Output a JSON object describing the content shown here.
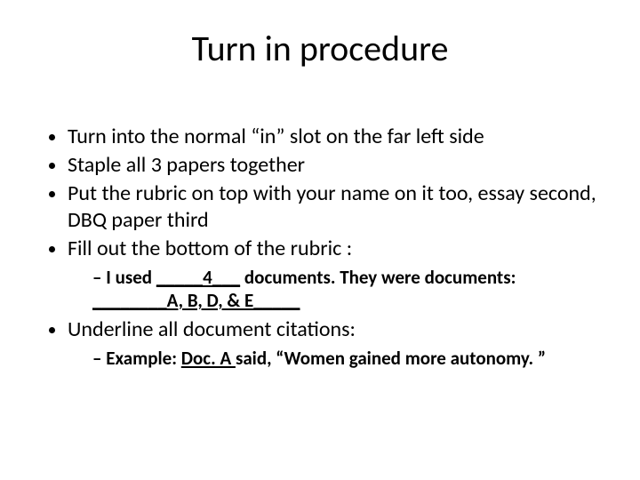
{
  "title": "Turn in procedure",
  "bullets": {
    "b1": "Turn into the normal “in” slot on the far left side",
    "b2": "Staple all 3 papers together",
    "b3": "Put the rubric on top with your name on it too, essay second, DBQ paper third",
    "b4": "Fill out the bottom of the rubric :",
    "b4sub": {
      "prefix": "I used ",
      "blank1": "_____4___",
      "mid": " documents.  They were documents: ",
      "blank2": "________A, B, D, & E_____"
    },
    "b5": "Underline all document citations:",
    "b5sub": {
      "prefix": "Example: ",
      "doc": "Doc. A ",
      "rest": "said, “Women gained more autonomy. ”"
    }
  }
}
